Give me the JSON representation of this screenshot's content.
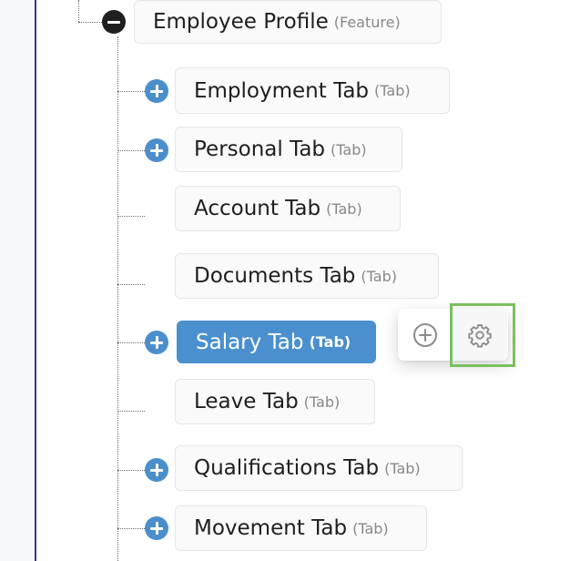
{
  "tree": {
    "root": {
      "title": "Employee Profile",
      "kind": "(Feature)",
      "state": "expanded"
    },
    "children": [
      {
        "title": "Employment Tab",
        "kind": "(Tab)",
        "expandable": true,
        "selected": false
      },
      {
        "title": "Personal Tab",
        "kind": "(Tab)",
        "expandable": true,
        "selected": false
      },
      {
        "title": "Account Tab",
        "kind": "(Tab)",
        "expandable": false,
        "selected": false
      },
      {
        "title": "Documents Tab",
        "kind": "(Tab)",
        "expandable": false,
        "selected": false
      },
      {
        "title": "Salary Tab",
        "kind": "(Tab)",
        "expandable": true,
        "selected": true
      },
      {
        "title": "Leave Tab",
        "kind": "(Tab)",
        "expandable": false,
        "selected": false
      },
      {
        "title": "Qualifications Tab",
        "kind": "(Tab)",
        "expandable": true,
        "selected": false
      },
      {
        "title": "Movement Tab",
        "kind": "(Tab)",
        "expandable": true,
        "selected": false
      }
    ]
  },
  "popover": {
    "add_icon": "plus-circle-icon",
    "settings_icon": "gear-icon",
    "highlighted": "settings"
  },
  "colors": {
    "selected_bg": "#4a90cf",
    "plus_toggle": "#4a8fcb",
    "minus_toggle": "#1f1f1f",
    "highlight": "#7ac05e",
    "left_border": "#2b3f86"
  }
}
